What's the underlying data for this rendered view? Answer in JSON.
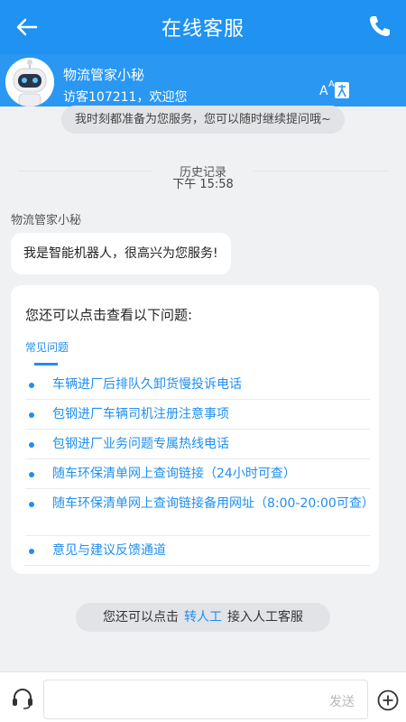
{
  "header": {
    "title": "在线客服",
    "back_icon": "arrow-left-icon",
    "phone_icon": "phone-icon",
    "color": "#1f92f2"
  },
  "agent": {
    "name": "物流管家小秘",
    "greeting": "访客107211，欢迎您",
    "avatar_icon": "robot-avatar-icon",
    "font_size_icon": "font-size-icon"
  },
  "tip": "我时刻都准备为您服务，您可以随时继续提问哦~",
  "history": {
    "label": "历史记录",
    "time": "下午 15:58"
  },
  "sender": "物流管家小秘",
  "bot_message": "我是智能机器人，很高兴为您服务!",
  "card": {
    "title": "您还可以点击查看以下问题:",
    "tab": "常见问题",
    "questions": [
      "车辆进厂后排队久卸货慢投诉电话",
      "包钢进厂车辆司机注册注意事项",
      "包钢进厂业务问题专属热线电话",
      "随车环保清单网上查询链接（24小时可查）",
      "随车环保清单网上查询链接备用网址（8:00-20:00可查）",
      "意见与建议反馈通道"
    ]
  },
  "transfer": {
    "prefix": "您还可以点击",
    "link": "转人工",
    "suffix": "接入人工客服"
  },
  "footer": {
    "input_placeholder": "",
    "send_label": "发送",
    "headset_icon": "headset-icon",
    "plus_icon": "plus-circle-icon"
  }
}
